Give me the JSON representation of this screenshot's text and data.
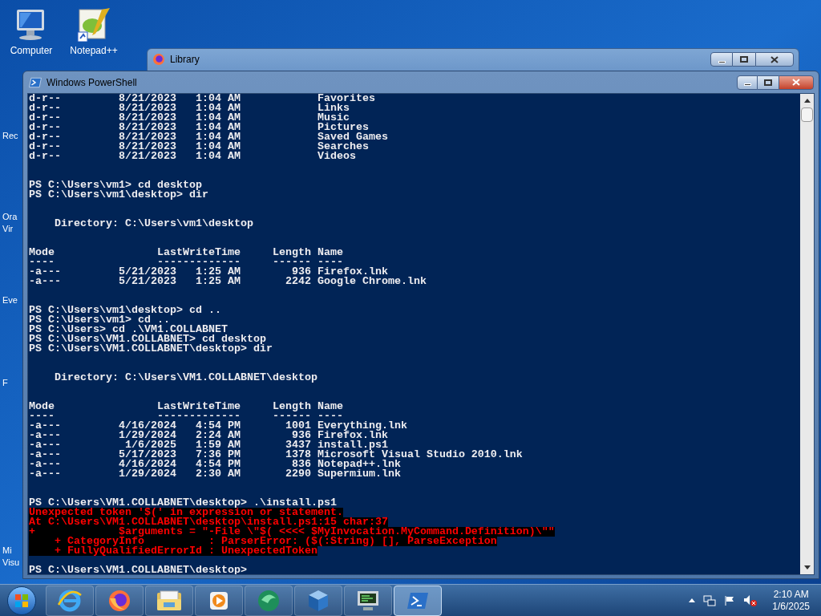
{
  "desktop_icons": [
    {
      "kind": "computer",
      "label": "Computer"
    },
    {
      "kind": "notepad",
      "label": "Notepad++"
    }
  ],
  "covered_icons": [
    {
      "lines": [
        "Rec"
      ]
    },
    {
      "lines": [
        "Ora",
        "Vir"
      ]
    },
    {
      "lines": [
        "Eve"
      ]
    },
    {
      "lines": [
        "F"
      ]
    },
    {
      "lines": [
        "Mi",
        "Visu"
      ]
    }
  ],
  "library_window": {
    "title": "Library"
  },
  "powershell_window": {
    "title": "Windows PowerShell",
    "lines": [
      {
        "kind": "text",
        "text": "d-r--         8/21/2023   1:04 AM            Favorites"
      },
      {
        "kind": "text",
        "text": "d-r--         8/21/2023   1:04 AM            Links"
      },
      {
        "kind": "text",
        "text": "d-r--         8/21/2023   1:04 AM            Music"
      },
      {
        "kind": "text",
        "text": "d-r--         8/21/2023   1:04 AM            Pictures"
      },
      {
        "kind": "text",
        "text": "d-r--         8/21/2023   1:04 AM            Saved Games"
      },
      {
        "kind": "text",
        "text": "d-r--         8/21/2023   1:04 AM            Searches"
      },
      {
        "kind": "text",
        "text": "d-r--         8/21/2023   1:04 AM            Videos"
      },
      {
        "kind": "blank"
      },
      {
        "kind": "blank"
      },
      {
        "kind": "text",
        "text": "PS C:\\Users\\vm1> cd desktop"
      },
      {
        "kind": "text",
        "text": "PS C:\\Users\\vm1\\desktop> dir"
      },
      {
        "kind": "blank"
      },
      {
        "kind": "blank"
      },
      {
        "kind": "text",
        "text": "    Directory: C:\\Users\\vm1\\desktop"
      },
      {
        "kind": "blank"
      },
      {
        "kind": "blank"
      },
      {
        "kind": "text",
        "text": "Mode                LastWriteTime     Length Name"
      },
      {
        "kind": "text",
        "text": "----                -------------     ------ ----"
      },
      {
        "kind": "text",
        "text": "-a---         5/21/2023   1:25 AM        936 Firefox.lnk"
      },
      {
        "kind": "text",
        "text": "-a---         5/21/2023   1:25 AM       2242 Google Chrome.lnk"
      },
      {
        "kind": "blank"
      },
      {
        "kind": "blank"
      },
      {
        "kind": "text",
        "text": "PS C:\\Users\\vm1\\desktop> cd .."
      },
      {
        "kind": "text",
        "text": "PS C:\\Users\\vm1> cd .."
      },
      {
        "kind": "text",
        "text": "PS C:\\Users> cd .\\VM1.COLLABNET"
      },
      {
        "kind": "text",
        "text": "PS C:\\Users\\VM1.COLLABNET> cd desktop"
      },
      {
        "kind": "text",
        "text": "PS C:\\Users\\VM1.COLLABNET\\desktop> dir"
      },
      {
        "kind": "blank"
      },
      {
        "kind": "blank"
      },
      {
        "kind": "text",
        "text": "    Directory: C:\\Users\\VM1.COLLABNET\\desktop"
      },
      {
        "kind": "blank"
      },
      {
        "kind": "blank"
      },
      {
        "kind": "text",
        "text": "Mode                LastWriteTime     Length Name"
      },
      {
        "kind": "text",
        "text": "----                -------------     ------ ----"
      },
      {
        "kind": "text",
        "text": "-a---         4/16/2024   4:54 PM       1001 Everything.lnk"
      },
      {
        "kind": "text",
        "text": "-a---         1/29/2024   2:24 AM        936 Firefox.lnk"
      },
      {
        "kind": "text",
        "text": "-a---          1/6/2025   1:59 AM       3437 install.ps1"
      },
      {
        "kind": "text",
        "text": "-a---         5/17/2023   7:36 PM       1378 Microsoft Visual Studio 2010.lnk"
      },
      {
        "kind": "text",
        "text": "-a---         4/16/2024   4:54 PM        836 Notepad++.lnk"
      },
      {
        "kind": "text",
        "text": "-a---         1/29/2024   2:30 AM       2290 Supermium.lnk"
      },
      {
        "kind": "blank"
      },
      {
        "kind": "blank"
      },
      {
        "kind": "text",
        "text": "PS C:\\Users\\VM1.COLLABNET\\desktop> .\\install.ps1"
      },
      {
        "kind": "error",
        "text": "Unexpected token '$(' in expression or statement."
      },
      {
        "kind": "error",
        "text": "At C:\\Users\\VM1.COLLABNET\\desktop\\install.ps1:15 char:37"
      },
      {
        "kind": "error",
        "text": "+             $arguments = \"-File \\\"$( <<<< $MyInvocation.MyCommand.Definition)\\\"\""
      },
      {
        "kind": "error",
        "text": "    + CategoryInfo          : ParserError: ($(:String) [], ParseException"
      },
      {
        "kind": "error",
        "text": "    + FullyQualifiedErrorId : UnexpectedToken"
      },
      {
        "kind": "blank"
      },
      {
        "kind": "text",
        "text": "PS C:\\Users\\VM1.COLLABNET\\desktop>"
      }
    ]
  },
  "taskbar": {
    "apps": [
      {
        "kind": "ie",
        "selected": false
      },
      {
        "kind": "firefox",
        "selected": false
      },
      {
        "kind": "explorer",
        "selected": false
      },
      {
        "kind": "media",
        "selected": false
      },
      {
        "kind": "green",
        "selected": false
      },
      {
        "kind": "virtualbox",
        "selected": false
      },
      {
        "kind": "monitor",
        "selected": false
      },
      {
        "kind": "powershell",
        "selected": true
      }
    ],
    "clock": {
      "time": "2:10 AM",
      "date": "1/6/2025"
    }
  }
}
